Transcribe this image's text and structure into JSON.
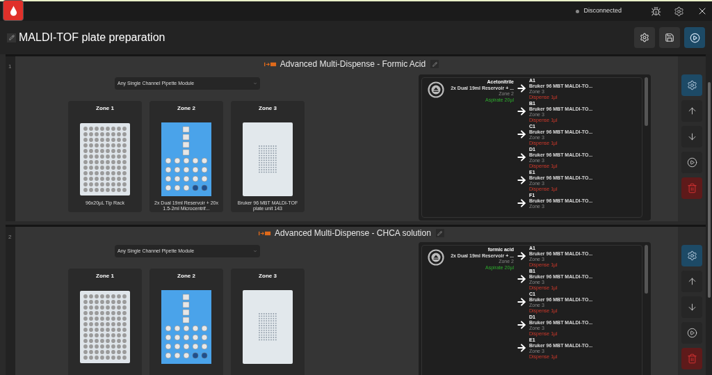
{
  "top_bar": {
    "status": "Disconnected"
  },
  "title": "MALDI-TOF plate preparation",
  "steps": [
    {
      "number": "1",
      "title": "Advanced Multi-Dispense - Formic Acid",
      "pipette": "Any Single Channel Pipette Module",
      "zones": [
        {
          "name": "Zone 1",
          "kind": "tip_rack",
          "label": "96x20µL Tip Rack"
        },
        {
          "name": "Zone 2",
          "kind": "reservoir",
          "label": "2x Dual 19ml Reservoir + 20x 1.5-2ml Microcentrif..."
        },
        {
          "name": "Zone 3",
          "kind": "maldi_plate",
          "label": "Bruker 96 MBT MALDI-TOF plate unit 143"
        }
      ],
      "source": {
        "liquid": "Acetonitrile",
        "labware": "2x Dual 19ml Reservoir + ...",
        "zone": "Zone 2",
        "action": "Aspirate 20µl"
      },
      "targets": [
        {
          "well": "A1",
          "labware": "Bruker 96 MBT MALDI-TO...",
          "zone": "Zone 3",
          "action": "Dispense 1µl"
        },
        {
          "well": "B1",
          "labware": "Bruker 96 MBT MALDI-TO...",
          "zone": "Zone 3",
          "action": "Dispense 1µl"
        },
        {
          "well": "C1",
          "labware": "Bruker 96 MBT MALDI-TO...",
          "zone": "Zone 3",
          "action": "Dispense 1µl"
        },
        {
          "well": "D1",
          "labware": "Bruker 96 MBT MALDI-TO...",
          "zone": "Zone 3",
          "action": "Dispense 1µl"
        },
        {
          "well": "E1",
          "labware": "Bruker 96 MBT MALDI-TO...",
          "zone": "Zone 3",
          "action": "Dispense 1µl"
        },
        {
          "well": "F1",
          "labware": "Bruker 96 MBT MALDI-TO...",
          "zone": "Zone 3"
        }
      ]
    },
    {
      "number": "2",
      "title": "Advanced Multi-Dispense - CHCA solution",
      "pipette": "Any Single Channel Pipette Module",
      "zones": [
        {
          "name": "Zone 1",
          "kind": "tip_rack"
        },
        {
          "name": "Zone 2",
          "kind": "reservoir"
        },
        {
          "name": "Zone 3",
          "kind": "maldi_plate"
        }
      ],
      "source": {
        "liquid": "formic acid",
        "labware": "2x Dual 19ml Reservoir + ...",
        "zone": "Zone 2",
        "action": "Aspirate 20µl"
      },
      "targets": [
        {
          "well": "A1",
          "labware": "Bruker 96 MBT MALDI-TO...",
          "zone": "Zone 3",
          "action": "Dispense 1µl"
        },
        {
          "well": "B1",
          "labware": "Bruker 96 MBT MALDI-TO...",
          "zone": "Zone 3",
          "action": "Dispense 1µl"
        },
        {
          "well": "C1",
          "labware": "Bruker 96 MBT MALDI-TO...",
          "zone": "Zone 3",
          "action": "Dispense 1µl"
        },
        {
          "well": "D1",
          "labware": "Bruker 96 MBT MALDI-TO...",
          "zone": "Zone 3",
          "action": "Dispense 1µl"
        },
        {
          "well": "E1",
          "labware": "Bruker 96 MBT MALDI-TO...",
          "zone": "Zone 3",
          "action": "Dispense 1µl"
        }
      ]
    }
  ],
  "step_controls": [
    {
      "kind": "settings"
    },
    {
      "kind": "up"
    },
    {
      "kind": "down"
    },
    {
      "kind": "run"
    },
    {
      "kind": "delete"
    }
  ]
}
